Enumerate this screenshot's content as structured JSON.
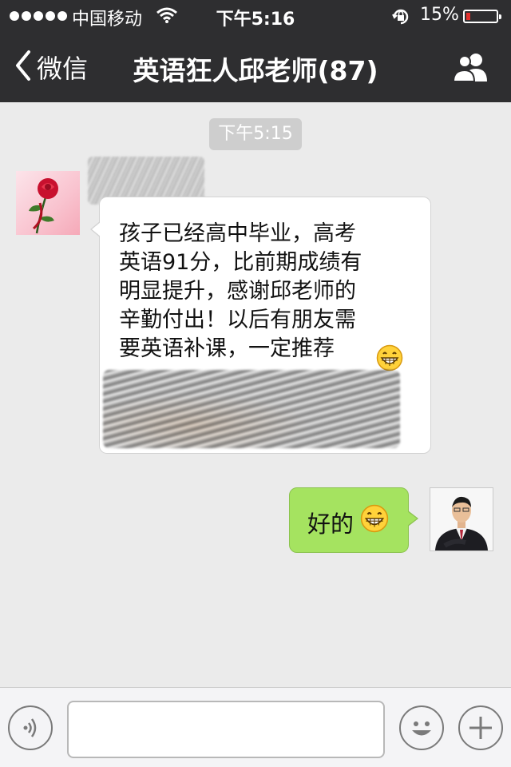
{
  "status_bar": {
    "carrier": "中国移动",
    "time": "下午5:16",
    "battery_percent": "15%",
    "battery_level": 0.15,
    "battery_color": "#e2302d",
    "icons": [
      "signal-dots-icon",
      "wifi-icon",
      "rotation-lock-icon",
      "battery-icon"
    ]
  },
  "nav": {
    "back_label": "微信",
    "title": "英语狂人邱老师(87)",
    "right_icon": "contacts-icon"
  },
  "chat": {
    "timestamp": "下午5:15",
    "incoming": {
      "lines": [
        "孩子已经高中毕业，高考",
        "英语91分，比前期成绩有",
        "明显提升，感谢邱老师的",
        "辛勤付出！以后有朋友需",
        "要英语补课，一定推荐"
      ],
      "trailing_emoji": "grin-emoji-icon",
      "avatar_icon": "rose-avatar-icon"
    },
    "outgoing": {
      "text": "好的",
      "trailing_emoji": "grin-emoji-icon",
      "avatar_icon": "teacher-photo-avatar"
    }
  },
  "input_bar": {
    "input_value": "",
    "placeholder": "",
    "left_icon": "voice-icon",
    "right_icons": [
      "emoji-face-icon",
      "plus-icon"
    ]
  },
  "colors": {
    "header_bg": "#2e2e30",
    "chat_bg": "#ebebeb",
    "outgoing_bubble": "#a5e360",
    "incoming_bubble": "#ffffff"
  }
}
